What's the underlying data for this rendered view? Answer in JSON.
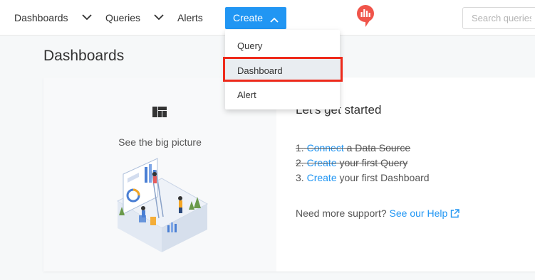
{
  "nav": {
    "dashboards": "Dashboards",
    "queries": "Queries",
    "alerts": "Alerts",
    "create": "Create"
  },
  "search": {
    "placeholder": "Search queries"
  },
  "dropdown": {
    "items": [
      {
        "label": "Query"
      },
      {
        "label": "Dashboard"
      },
      {
        "label": "Alert"
      }
    ]
  },
  "page": {
    "title": "Dashboards"
  },
  "empty_state": {
    "tagline": "See the big picture",
    "heading": "Let's get started",
    "steps": [
      {
        "num": "1.",
        "link": "Connect",
        "rest": " a Data Source"
      },
      {
        "num": "2.",
        "link": "Create",
        "rest": " your first Query"
      },
      {
        "num": "3.",
        "link": "Create",
        "rest": " your first Dashboard"
      }
    ],
    "support_text": "Need more support? ",
    "help_link": "See our Help"
  },
  "colors": {
    "accent": "#2196f3",
    "highlight": "#ee2a1b",
    "logo": "#f0544a"
  }
}
